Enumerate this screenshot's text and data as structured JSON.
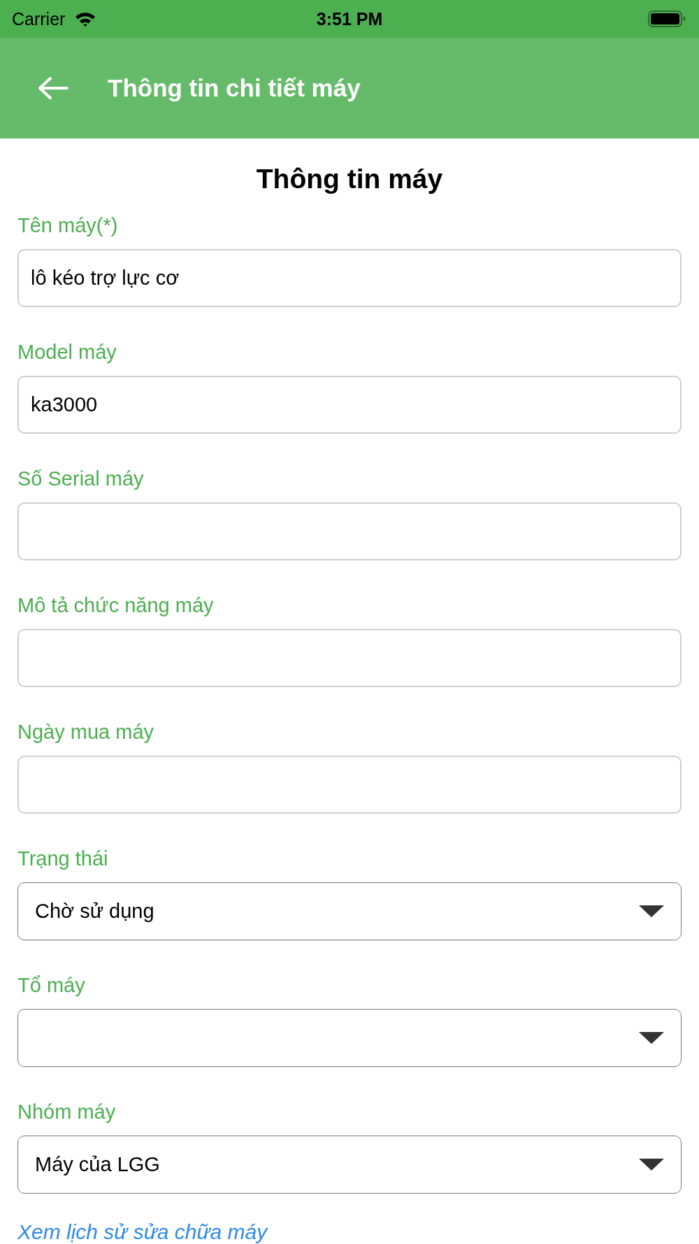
{
  "status_bar": {
    "carrier": "Carrier",
    "time": "3:51 PM"
  },
  "header": {
    "title": "Thông tin chi tiết máy"
  },
  "section_title": "Thông tin máy",
  "fields": [
    {
      "kind": "text",
      "label": "Tên máy(*)",
      "value": "lô kéo trợ lực cơ"
    },
    {
      "kind": "text",
      "label": "Model máy",
      "value": "ka3000"
    },
    {
      "kind": "text",
      "label": "Số Serial máy"
    },
    {
      "kind": "text",
      "label": "Mô tả chức năng máy"
    },
    {
      "kind": "text",
      "label": "Ngày mua máy"
    },
    {
      "kind": "select",
      "label": "Trạng thái",
      "value": "Chờ sử dụng"
    },
    {
      "kind": "select",
      "label": "Tổ máy"
    },
    {
      "kind": "select",
      "label": "Nhóm máy",
      "value": "Máy của LGG"
    }
  ],
  "link": "Xem lịch sử sửa chữa máy"
}
